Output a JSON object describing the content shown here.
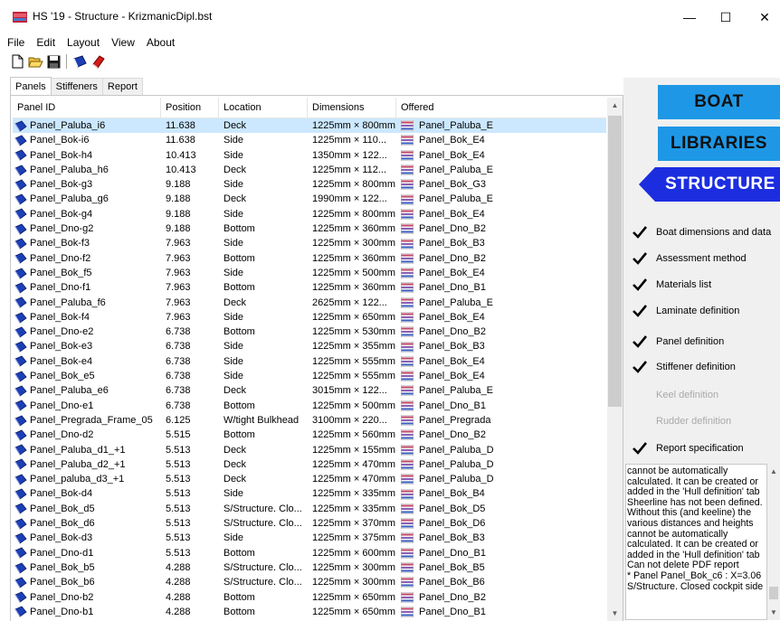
{
  "window": {
    "title": "HS '19 - Structure - KrizmanicDipl.bst",
    "minimize": "—",
    "maximize": "☐",
    "close": "✕"
  },
  "menu": [
    "File",
    "Edit",
    "Layout",
    "View",
    "About"
  ],
  "toolbar": [
    {
      "name": "new-file-icon"
    },
    {
      "name": "open-folder-icon"
    },
    {
      "name": "save-disk-icon"
    },
    {
      "name": "blue-book-icon"
    },
    {
      "name": "red-book-icon"
    }
  ],
  "tabs": [
    {
      "label": "Panels",
      "active": true
    },
    {
      "label": "Stiffeners"
    },
    {
      "label": "Report"
    }
  ],
  "grid": {
    "headers": [
      "Panel ID",
      "Position",
      "Location",
      "Dimensions",
      "Offered"
    ],
    "rows": [
      [
        "Panel_Paluba_i6",
        "11.638",
        "Deck",
        "1225mm × 800mm",
        "Panel_Paluba_E"
      ],
      [
        "Panel_Bok-i6",
        "11.638",
        "Side",
        "1225mm × 110...",
        "Panel_Bok_E4"
      ],
      [
        "Panel_Bok-h4",
        "10.413",
        "Side",
        "1350mm × 122...",
        "Panel_Bok_E4"
      ],
      [
        "Panel_Paluba_h6",
        "10.413",
        "Deck",
        "1225mm × 112...",
        "Panel_Paluba_E"
      ],
      [
        "Panel_Bok-g3",
        "9.188",
        "Side",
        "1225mm × 800mm",
        "Panel_Bok_G3"
      ],
      [
        "Panel_Paluba_g6",
        "9.188",
        "Deck",
        "1990mm × 122...",
        "Panel_Paluba_E"
      ],
      [
        "Panel_Bok-g4",
        "9.188",
        "Side",
        "1225mm × 800mm",
        "Panel_Bok_E4"
      ],
      [
        "Panel_Dno-g2",
        "9.188",
        "Bottom",
        "1225mm × 360mm",
        "Panel_Dno_B2"
      ],
      [
        "Panel_Bok-f3",
        "7.963",
        "Side",
        "1225mm × 300mm",
        "Panel_Bok_B3"
      ],
      [
        "Panel_Dno-f2",
        "7.963",
        "Bottom",
        "1225mm × 360mm",
        "Panel_Dno_B2"
      ],
      [
        "Panel_Bok_f5",
        "7.963",
        "Side",
        "1225mm × 500mm",
        "Panel_Bok_E4"
      ],
      [
        "Panel_Dno-f1",
        "7.963",
        "Bottom",
        "1225mm × 360mm",
        "Panel_Dno_B1"
      ],
      [
        "Panel_Paluba_f6",
        "7.963",
        "Deck",
        "2625mm × 122...",
        "Panel_Paluba_E"
      ],
      [
        "Panel_Bok-f4",
        "7.963",
        "Side",
        "1225mm × 650mm",
        "Panel_Bok_E4"
      ],
      [
        "Panel_Dno-e2",
        "6.738",
        "Bottom",
        "1225mm × 530mm",
        "Panel_Dno_B2"
      ],
      [
        "Panel_Bok-e3",
        "6.738",
        "Side",
        "1225mm × 355mm",
        "Panel_Bok_B3"
      ],
      [
        "Panel_Bok-e4",
        "6.738",
        "Side",
        "1225mm × 555mm",
        "Panel_Bok_E4"
      ],
      [
        "Panel_Bok_e5",
        "6.738",
        "Side",
        "1225mm × 555mm",
        "Panel_Bok_E4"
      ],
      [
        "Panel_Paluba_e6",
        "6.738",
        "Deck",
        "3015mm × 122...",
        "Panel_Paluba_E"
      ],
      [
        "Panel_Dno-e1",
        "6.738",
        "Bottom",
        "1225mm × 500mm",
        "Panel_Dno_B1"
      ],
      [
        "Panel_Pregrada_Frame_05",
        "6.125",
        "W/tight Bulkhead",
        "3100mm × 220...",
        "Panel_Pregrada"
      ],
      [
        "Panel_Dno-d2",
        "5.515",
        "Bottom",
        "1225mm × 560mm",
        "Panel_Dno_B2"
      ],
      [
        "Panel_Paluba_d1_+1",
        "5.513",
        "Deck",
        "1225mm × 155mm",
        "Panel_Paluba_D"
      ],
      [
        "Panel_Paluba_d2_+1",
        "5.513",
        "Deck",
        "1225mm × 470mm",
        "Panel_Paluba_D"
      ],
      [
        "Panel_paluba_d3_+1",
        "5.513",
        "Deck",
        "1225mm × 470mm",
        "Panel_Paluba_D"
      ],
      [
        "Panel_Bok-d4",
        "5.513",
        "Side",
        "1225mm × 335mm",
        "Panel_Bok_B4"
      ],
      [
        "Panel_Bok_d5",
        "5.513",
        "S/Structure. Clo...",
        "1225mm × 335mm",
        "Panel_Bok_D5"
      ],
      [
        "Panel_Bok_d6",
        "5.513",
        "S/Structure. Clo...",
        "1225mm × 370mm",
        "Panel_Bok_D6"
      ],
      [
        "Panel_Bok-d3",
        "5.513",
        "Side",
        "1225mm × 375mm",
        "Panel_Bok_B3"
      ],
      [
        "Panel_Dno-d1",
        "5.513",
        "Bottom",
        "1225mm × 600mm",
        "Panel_Dno_B1"
      ],
      [
        "Panel_Bok_b5",
        "4.288",
        "S/Structure. Clo...",
        "1225mm × 300mm",
        "Panel_Bok_B5"
      ],
      [
        "Panel_Bok_b6",
        "4.288",
        "S/Structure. Clo...",
        "1225mm × 300mm",
        "Panel_Bok_B6"
      ],
      [
        "Panel_Dno-b2",
        "4.288",
        "Bottom",
        "1225mm × 650mm",
        "Panel_Dno_B2"
      ],
      [
        "Panel_Dno-b1",
        "4.288",
        "Bottom",
        "1225mm × 650mm",
        "Panel_Dno_B1"
      ]
    ]
  },
  "side_buttons": {
    "boat": "BOAT",
    "libraries": "LIBRARIES",
    "structure": "STRUCTURE"
  },
  "checklist": [
    {
      "label": "Boat dimensions and data",
      "checked": true
    },
    {
      "label": "Assessment method",
      "checked": true
    },
    {
      "label": "Materials list",
      "checked": true
    },
    {
      "label": "Laminate definition",
      "checked": true
    },
    {
      "label": "Panel definition",
      "checked": true
    },
    {
      "label": "Stiffener definition",
      "checked": true
    },
    {
      "label": "Keel definition",
      "checked": false
    },
    {
      "label": "Rudder definition",
      "checked": false
    },
    {
      "label": "Report specification",
      "checked": true
    }
  ],
  "log": [
    "cannot be automatically",
    "calculated. It can be created or",
    "added in the 'Hull definition' tab",
    "Sheerline has not been defined.",
    "Without this (and keeline) the",
    "various distances and heights",
    "cannot be automatically",
    "calculated. It can be created or",
    "added in the 'Hull definition' tab",
    " Can not delete PDF report",
    " * Panel Panel_Bok_c6 : X=3.06",
    "S/Structure. Closed cockpit side"
  ],
  "colors": {
    "accent": "#1e98e6",
    "selection": "#cce8ff",
    "panel_bg": "#f0f0f0"
  }
}
